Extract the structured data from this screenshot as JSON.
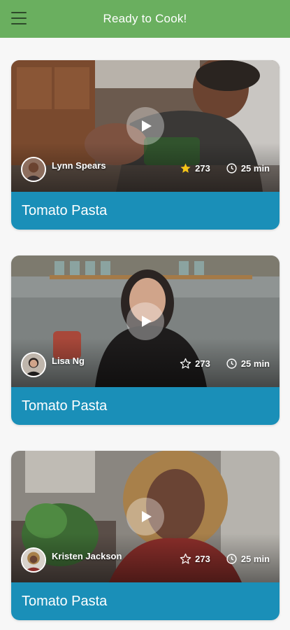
{
  "appbar": {
    "title": "Ready to Cook!",
    "menu_icon": "hamburger-menu-icon",
    "background": "#6aaf5f"
  },
  "cards": [
    {
      "author": "Lynn Spears",
      "rating_count": "273",
      "rated": true,
      "duration": "25 min",
      "title": "Tomato Pasta"
    },
    {
      "author": "Lisa Ng",
      "rating_count": "273",
      "rated": false,
      "duration": "25 min",
      "title": "Tomato Pasta"
    },
    {
      "author": "Kristen Jackson",
      "rating_count": "273",
      "rated": false,
      "duration": "25 min",
      "title": "Tomato Pasta"
    }
  ],
  "colors": {
    "title_bar": "#1a8fb8",
    "star_filled": "#f5c518",
    "page_background": "#f7f7f7"
  }
}
